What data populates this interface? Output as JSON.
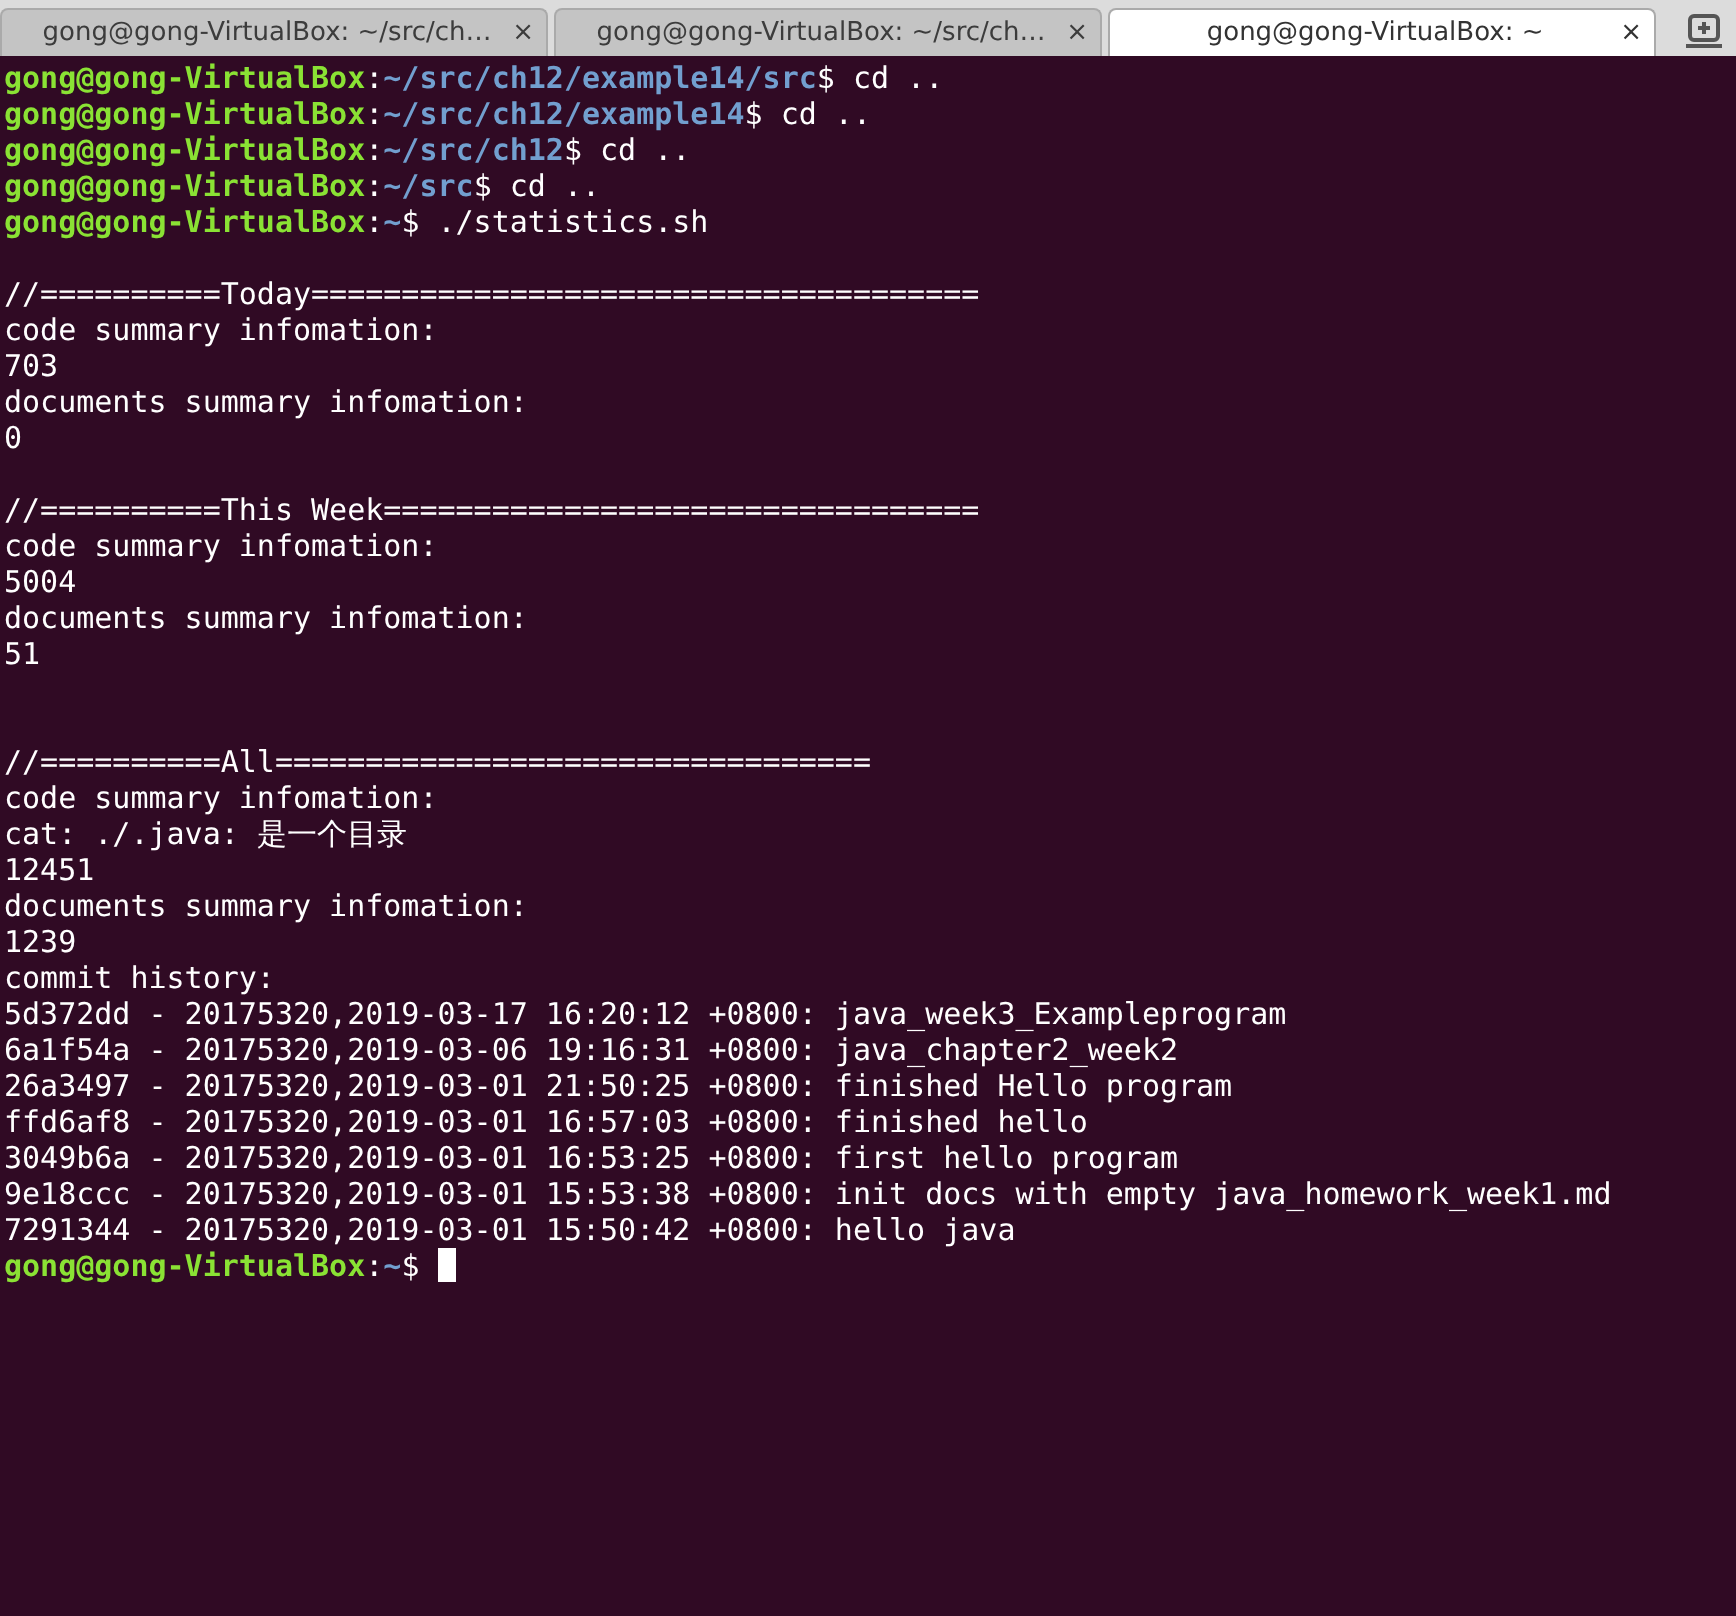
{
  "tabs": [
    {
      "title": "gong@gong-VirtualBox: ~/src/ch…",
      "close": "×",
      "selected": false
    },
    {
      "title": "gong@gong-VirtualBox: ~/src/ch…",
      "close": "×",
      "selected": false
    },
    {
      "title": "gong@gong-VirtualBox: ~",
      "close": "×",
      "selected": true
    }
  ],
  "terminal": {
    "lines": [
      {
        "kind": "prompt",
        "user": "gong@gong-VirtualBox",
        "sep": ":",
        "path": "~/src/ch12/example14/src",
        "tail": "$ cd .."
      },
      {
        "kind": "prompt",
        "user": "gong@gong-VirtualBox",
        "sep": ":",
        "path": "~/src/ch12/example14",
        "tail": "$ cd .."
      },
      {
        "kind": "prompt",
        "user": "gong@gong-VirtualBox",
        "sep": ":",
        "path": "~/src/ch12",
        "tail": "$ cd .."
      },
      {
        "kind": "prompt",
        "user": "gong@gong-VirtualBox",
        "sep": ":",
        "path": "~/src",
        "tail": "$ cd .."
      },
      {
        "kind": "prompt",
        "user": "gong@gong-VirtualBox",
        "sep": ":",
        "path": "~",
        "tail": "$ ./statistics.sh"
      },
      {
        "kind": "blank"
      },
      {
        "kind": "output",
        "text": "//==========Today====================================="
      },
      {
        "kind": "output",
        "text": "code summary infomation:"
      },
      {
        "kind": "output",
        "text": "703"
      },
      {
        "kind": "output",
        "text": "documents summary infomation:"
      },
      {
        "kind": "output",
        "text": "0"
      },
      {
        "kind": "blank"
      },
      {
        "kind": "output",
        "text": "//==========This Week================================="
      },
      {
        "kind": "output",
        "text": "code summary infomation:"
      },
      {
        "kind": "output",
        "text": "5004"
      },
      {
        "kind": "output",
        "text": "documents summary infomation:"
      },
      {
        "kind": "output",
        "text": "51"
      },
      {
        "kind": "blank"
      },
      {
        "kind": "blank"
      },
      {
        "kind": "output",
        "text": "//==========All================================="
      },
      {
        "kind": "output",
        "text": "code summary infomation:"
      },
      {
        "kind": "output",
        "text": "cat: ./.java: 是一个目录"
      },
      {
        "kind": "output",
        "text": "12451"
      },
      {
        "kind": "output",
        "text": "documents summary infomation:"
      },
      {
        "kind": "output",
        "text": "1239"
      },
      {
        "kind": "output",
        "text": "commit history:"
      },
      {
        "kind": "output",
        "text": "5d372dd - 20175320,2019-03-17 16:20:12 +0800: java_week3_Exampleprogram"
      },
      {
        "kind": "output",
        "text": "6a1f54a - 20175320,2019-03-06 19:16:31 +0800: java_chapter2_week2"
      },
      {
        "kind": "output",
        "text": "26a3497 - 20175320,2019-03-01 21:50:25 +0800: finished Hello program"
      },
      {
        "kind": "output",
        "text": "ffd6af8 - 20175320,2019-03-01 16:57:03 +0800: finished hello"
      },
      {
        "kind": "output",
        "text": "3049b6a - 20175320,2019-03-01 16:53:25 +0800: first hello program"
      },
      {
        "kind": "output",
        "text": "9e18ccc - 20175320,2019-03-01 15:53:38 +0800: init docs with empty java_homework_week1.md"
      },
      {
        "kind": "output",
        "text": "7291344 - 20175320,2019-03-01 15:50:42 +0800: hello java"
      },
      {
        "kind": "prompt",
        "user": "gong@gong-VirtualBox",
        "sep": ":",
        "path": "~",
        "tail": "$",
        "cursor": true
      }
    ]
  }
}
